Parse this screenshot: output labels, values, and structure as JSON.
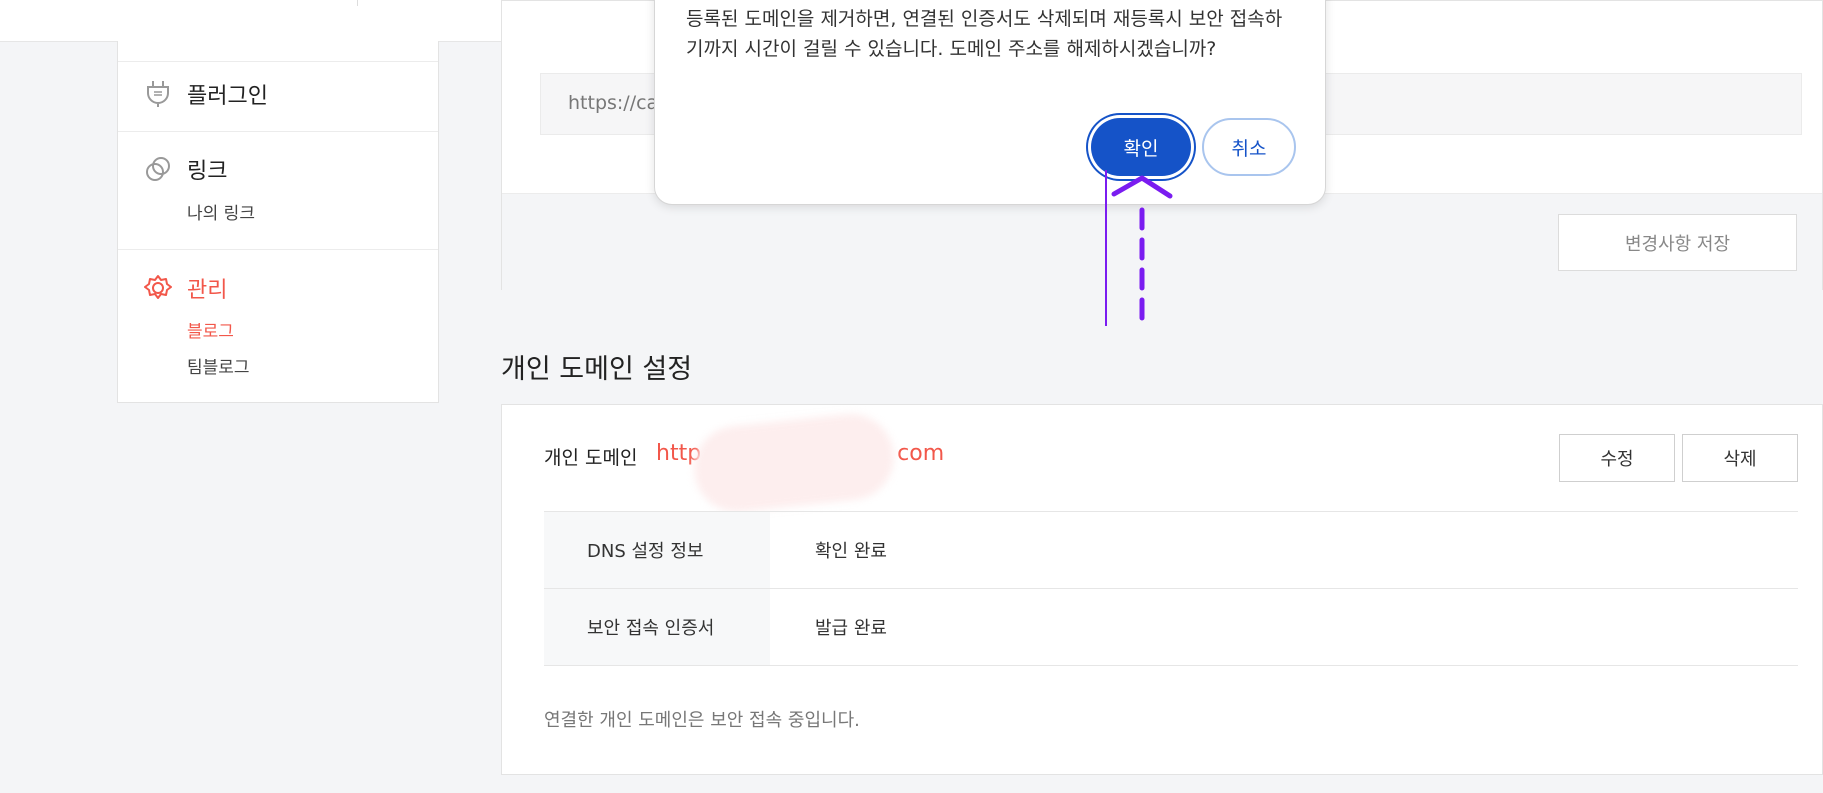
{
  "sidebar": {
    "plugin_label": "플러그인",
    "link_label": "링크",
    "link_sub": "나의 링크",
    "manage_label": "관리",
    "manage_sub_blog": "블로그",
    "manage_sub_teamblog": "팀블로그"
  },
  "top_panel": {
    "url_value": "https://ca",
    "save_button": "변경사항 저장"
  },
  "modal": {
    "message": "등록된 도메인을 제거하면, 연결된 인증서도 삭제되며 재등록시 보안 접속하기까지 시간이 걸릴 수 있습니다. 도메인 주소를 해제하시겠습니까?",
    "confirm": "확인",
    "cancel": "취소"
  },
  "domain_section": {
    "title": "개인 도메인 설정",
    "label": "개인 도메인",
    "url_start": "http",
    "url_end": "com",
    "edit_button": "수정",
    "delete_button": "삭제",
    "rows": [
      {
        "head": "DNS 설정 정보",
        "value": "확인 완료"
      },
      {
        "head": "보안 접속 인증서",
        "value": "발급 완료"
      }
    ],
    "note": "연결한 개인 도메인은 보안 접속 중입니다."
  },
  "colors": {
    "accent": "#f2574a",
    "primary": "#1553c8",
    "annotation": "#7a1cf0"
  },
  "icons": [
    "plug-icon",
    "link-icon",
    "gear-icon"
  ]
}
